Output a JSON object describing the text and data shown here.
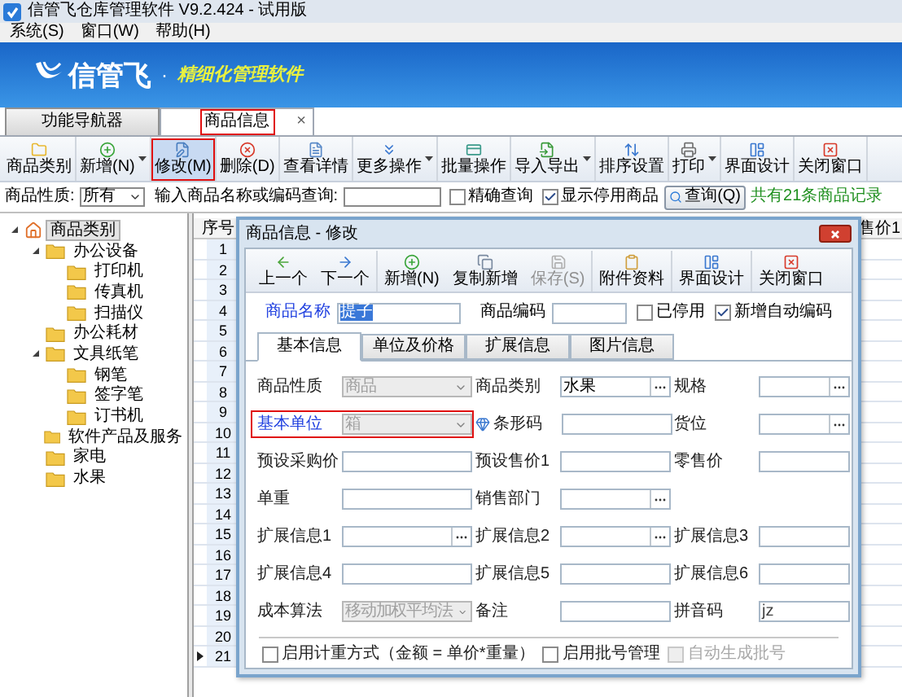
{
  "window": {
    "title": "信管飞仓库管理软件 V9.2.424 - 试用版"
  },
  "menu": [
    "系统(S)",
    "窗口(W)",
    "帮助(H)"
  ],
  "banner": {
    "brand": "信管飞",
    "separator": "·",
    "slogan": "精细化管理软件"
  },
  "tabs": [
    {
      "label": "功能导航器",
      "selected": false,
      "highlighted": false
    },
    {
      "label": "商品信息",
      "selected": true,
      "highlighted": true,
      "close": "×"
    }
  ],
  "toolbar": [
    {
      "label": "商品类别",
      "dropdown": false,
      "selected": false,
      "highlighted": false
    },
    {
      "label": "新增(N)",
      "dropdown": true,
      "selected": false,
      "highlighted": false
    },
    {
      "label": "修改(M)",
      "dropdown": false,
      "selected": true,
      "highlighted": true
    },
    {
      "label": "删除(D)",
      "dropdown": false,
      "selected": false,
      "highlighted": false
    },
    {
      "label": "查看详情",
      "dropdown": false,
      "selected": false,
      "highlighted": false
    },
    {
      "label": "更多操作",
      "dropdown": true,
      "selected": false,
      "highlighted": false
    },
    {
      "label": "批量操作",
      "dropdown": false,
      "selected": false,
      "highlighted": false
    },
    {
      "label": "导入导出",
      "dropdown": true,
      "selected": false,
      "highlighted": false
    },
    {
      "label": "排序设置",
      "dropdown": false,
      "selected": false,
      "highlighted": false
    },
    {
      "label": "打印",
      "dropdown": true,
      "selected": false,
      "highlighted": false
    },
    {
      "label": "界面设计",
      "dropdown": false,
      "selected": false,
      "highlighted": false
    },
    {
      "label": "关闭窗口",
      "dropdown": false,
      "selected": false,
      "highlighted": false
    }
  ],
  "filter": {
    "type_label": "商品性质:",
    "type_value": "所有",
    "search_label": "输入商品名称或编码查询:",
    "checkboxes": [
      {
        "label": "精确查询",
        "checked": false
      },
      {
        "label": "显示停用商品",
        "checked": true
      }
    ],
    "query_button": "查询(Q)",
    "count": "共有21条商品记录"
  },
  "tree": [
    {
      "label": "商品类别",
      "selected": true,
      "expanded": true,
      "children": [
        {
          "label": "办公设备",
          "selected": false,
          "expanded": true,
          "children": [
            {
              "label": "打印机",
              "selected": false,
              "expanded": false
            },
            {
              "label": "传真机",
              "selected": false,
              "expanded": false
            },
            {
              "label": "扫描仪",
              "selected": false,
              "expanded": false
            }
          ]
        },
        {
          "label": "办公耗材",
          "selected": false,
          "expanded": false
        },
        {
          "label": "文具纸笔",
          "selected": false,
          "expanded": true,
          "children": [
            {
              "label": "钢笔",
              "selected": false,
              "expanded": false
            },
            {
              "label": "签字笔",
              "selected": false,
              "expanded": false
            },
            {
              "label": "订书机",
              "selected": false,
              "expanded": false
            }
          ]
        },
        {
          "label": "软件产品及服务",
          "selected": false,
          "expanded": false
        },
        {
          "label": "家电",
          "selected": false,
          "expanded": false
        },
        {
          "label": "水果",
          "selected": false,
          "expanded": false
        }
      ]
    }
  ],
  "grid": {
    "columns": [
      "序号",
      "售价1"
    ],
    "rows": [
      {
        "index": "1",
        "current": false
      },
      {
        "index": "2",
        "current": false
      },
      {
        "index": "3",
        "current": false
      },
      {
        "index": "4",
        "current": false
      },
      {
        "index": "5",
        "current": false
      },
      {
        "index": "6",
        "current": false
      },
      {
        "index": "7",
        "current": false
      },
      {
        "index": "8",
        "current": false
      },
      {
        "index": "9",
        "current": false
      },
      {
        "index": "10",
        "current": false
      },
      {
        "index": "11",
        "current": false
      },
      {
        "index": "12",
        "current": false
      },
      {
        "index": "13",
        "current": false
      },
      {
        "index": "14",
        "current": false
      },
      {
        "index": "15",
        "current": false
      },
      {
        "index": "16",
        "current": false
      },
      {
        "index": "17",
        "current": false
      },
      {
        "index": "18",
        "current": false
      },
      {
        "index": "19",
        "current": false
      },
      {
        "index": "20",
        "current": false
      },
      {
        "index": "21",
        "current": true
      }
    ]
  },
  "dialog": {
    "title": "商品信息 - 修改",
    "toolbar": [
      {
        "label": "上一个",
        "disabled": false
      },
      {
        "label": "下一个",
        "disabled": false
      },
      {
        "label": "新增(N)",
        "disabled": false
      },
      {
        "label": "复制新增",
        "disabled": false
      },
      {
        "label": "保存(S)",
        "disabled": true
      },
      {
        "label": "附件资料",
        "disabled": false
      },
      {
        "label": "界面设计",
        "disabled": false
      },
      {
        "label": "关闭窗口",
        "disabled": false
      }
    ],
    "name_label": "商品名称",
    "name_value": "提子",
    "name_selected": true,
    "code_label": "商品编码",
    "options": [
      {
        "label": "已停用",
        "checked": false
      },
      {
        "label": "新增自动编码",
        "checked": true
      }
    ],
    "tabs": [
      {
        "label": "基本信息",
        "selected": true
      },
      {
        "label": "单位及价格",
        "selected": false
      },
      {
        "label": "扩展信息",
        "selected": false
      },
      {
        "label": "图片信息",
        "selected": false
      }
    ],
    "form": [
      [
        {
          "label": "商品性质",
          "kind": "select",
          "value": "商品",
          "disabled": true,
          "required": false,
          "highlighted": false
        },
        {
          "label": "商品类别",
          "kind": "lookup",
          "value": "水果",
          "disabled": false,
          "required": false,
          "highlighted": false
        },
        {
          "label": "规格",
          "kind": "lookup",
          "disabled": false,
          "required": false,
          "highlighted": false
        }
      ],
      [
        {
          "label": "基本单位",
          "kind": "select",
          "value": "箱",
          "disabled": true,
          "required": true,
          "highlighted": true
        },
        {
          "label": "条形码",
          "kind": "text",
          "icon": true,
          "disabled": false,
          "required": false,
          "highlighted": false
        },
        {
          "label": "货位",
          "kind": "lookup",
          "disabled": false,
          "required": false,
          "highlighted": false
        }
      ],
      [
        {
          "label": "预设采购价",
          "kind": "text",
          "disabled": false,
          "required": false,
          "highlighted": false
        },
        {
          "label": "预设售价1",
          "kind": "text",
          "disabled": false,
          "required": false,
          "highlighted": false
        },
        {
          "label": "零售价",
          "kind": "text",
          "disabled": false,
          "required": false,
          "highlighted": false
        }
      ],
      [
        {
          "label": "单重",
          "kind": "text",
          "disabled": false,
          "required": false,
          "highlighted": false
        },
        {
          "label": "销售部门",
          "kind": "lookup",
          "disabled": false,
          "required": false,
          "highlighted": false
        }
      ],
      [
        {
          "label": "扩展信息1",
          "kind": "lookup",
          "disabled": false,
          "required": false,
          "highlighted": false
        },
        {
          "label": "扩展信息2",
          "kind": "lookup",
          "disabled": false,
          "required": false,
          "highlighted": false
        },
        {
          "label": "扩展信息3",
          "kind": "text",
          "disabled": false,
          "required": false,
          "highlighted": false
        }
      ],
      [
        {
          "label": "扩展信息4",
          "kind": "text",
          "disabled": false,
          "required": false,
          "highlighted": false
        },
        {
          "label": "扩展信息5",
          "kind": "text",
          "disabled": false,
          "required": false,
          "highlighted": false
        },
        {
          "label": "扩展信息6",
          "kind": "text",
          "disabled": false,
          "required": false,
          "highlighted": false
        }
      ],
      [
        {
          "label": "成本算法",
          "kind": "select",
          "value": "移动加权平均法",
          "disabled": true,
          "required": false,
          "highlighted": false
        },
        {
          "label": "备注",
          "kind": "text",
          "disabled": false,
          "required": false,
          "highlighted": false
        },
        {
          "label": "拼音码",
          "kind": "text",
          "value": "jz",
          "disabled": false,
          "required": false,
          "highlighted": false
        }
      ]
    ],
    "checkboxes": [
      {
        "label": "启用计重方式（金额 = 单价*重量）",
        "checked": false,
        "disabled": false
      },
      {
        "label": "启用批号管理",
        "checked": false,
        "disabled": false
      },
      {
        "label": "自动生成批号",
        "checked": false,
        "disabled": true
      }
    ]
  }
}
